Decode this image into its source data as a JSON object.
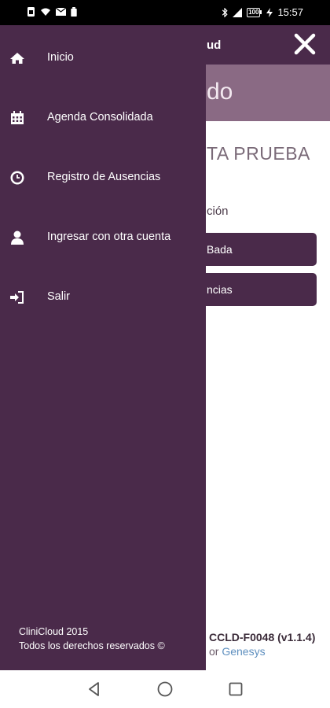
{
  "status_bar": {
    "time": "15:57",
    "battery": "100"
  },
  "underlay": {
    "app_name": "ud",
    "banner_text": "do",
    "patient_text": "TA PRUEBA",
    "section_label": "ción",
    "buttons": [
      "Bada",
      "ncias"
    ],
    "footer_code": "CCLD-F0048 (v1.1.4)",
    "footer_by": "or",
    "footer_link": "Genesys"
  },
  "drawer": {
    "items": [
      {
        "label": "Inicio",
        "icon": "home-icon"
      },
      {
        "label": "Agenda Consolidada",
        "icon": "calendar-icon"
      },
      {
        "label": "Registro de Ausencias",
        "icon": "clock-icon"
      },
      {
        "label": "Ingresar con otra cuenta",
        "icon": "user-icon"
      },
      {
        "label": "Salir",
        "icon": "sign-out-icon"
      }
    ],
    "footer_line1": "CliniCloud 2015",
    "footer_line2": "Todos los derechos reservados ©"
  },
  "colors": {
    "primary": "#4a2a4a",
    "banner": "#8a6a84",
    "link": "#5e8fbf"
  }
}
